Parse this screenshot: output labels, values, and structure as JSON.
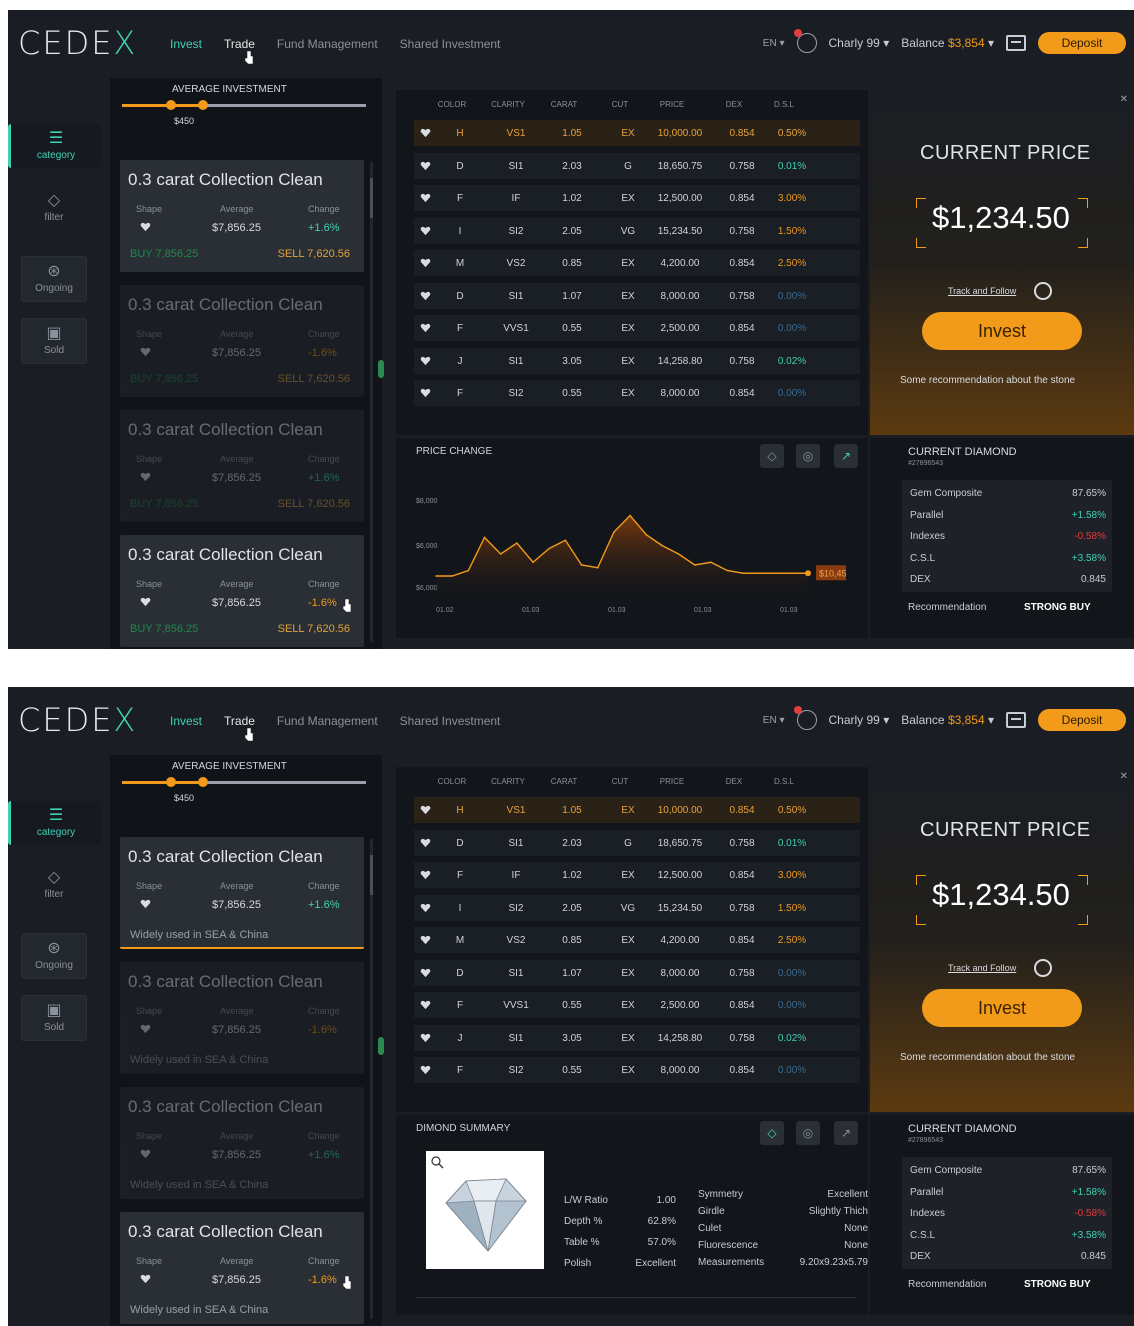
{
  "app": {
    "logo": "CEDEX",
    "nav": [
      "Invest",
      "Trade",
      "Fund Management",
      "Shared Investment"
    ],
    "lang": "EN",
    "user": "Charly 99",
    "balance_label": "Balance",
    "balance_value": "$3,854",
    "deposit": "Deposit"
  },
  "rail": {
    "items": [
      {
        "label": "category",
        "icon": "list-icon"
      },
      {
        "label": "filter",
        "icon": "diamond-icon"
      },
      {
        "label": "Ongoing",
        "icon": "ongoing-icon"
      },
      {
        "label": "Sold",
        "icon": "sold-icon"
      }
    ]
  },
  "average": {
    "title": "AVERAGE INVESTMENT",
    "value": "$450"
  },
  "card_labels": {
    "shape": "Shape",
    "average": "Average",
    "change": "Change"
  },
  "cards": [
    {
      "title": "0.3 carat Collection Clean",
      "average": "$7,856.25",
      "change": "+1.6%",
      "buy": "BUY 7,856.25",
      "sell": "SELL 7,620.56",
      "note": "Widely used in SEA & China"
    },
    {
      "title": "0.3 carat Collection Clean",
      "average": "$7,856.25",
      "change": "-1.6%",
      "buy": "BUY 7,856.25",
      "sell": "SELL 7,620.56",
      "note": "Widely used in SEA & China"
    },
    {
      "title": "0.3 carat Collection Clean",
      "average": "$7,856.25",
      "change": "+1.6%",
      "buy": "BUY 7,856.25",
      "sell": "SELL 7,620.56",
      "note": "Widely used in SEA & China"
    },
    {
      "title": "0.3 carat Collection Clean",
      "average": "$7,856.25",
      "change": "-1.6%",
      "buy": "BUY 7,856.25",
      "sell": "SELL 7,620.56",
      "note": "Widely used in SEA & China"
    }
  ],
  "table": {
    "headers": [
      "COLOR",
      "CLARITY",
      "CARAT",
      "CUT",
      "PRICE",
      "DEX",
      "D.S.L"
    ],
    "rows": [
      [
        "H",
        "VS1",
        "1.05",
        "EX",
        "10,000.00",
        "0.854",
        "0.50%"
      ],
      [
        "D",
        "SI1",
        "2.03",
        "G",
        "18,650.75",
        "0.758",
        "0.01%"
      ],
      [
        "F",
        "IF",
        "1.02",
        "EX",
        "12,500.00",
        "0.854",
        "3.00%"
      ],
      [
        "I",
        "SI2",
        "2.05",
        "VG",
        "15,234.50",
        "0.758",
        "1.50%"
      ],
      [
        "M",
        "VS2",
        "0.85",
        "EX",
        "4,200.00",
        "0.854",
        "2.50%"
      ],
      [
        "D",
        "SI1",
        "1.07",
        "EX",
        "8,000.00",
        "0.758",
        "0.00%"
      ],
      [
        "F",
        "VVS1",
        "0.55",
        "EX",
        "2,500.00",
        "0.854",
        "0.00%"
      ],
      [
        "J",
        "SI1",
        "3.05",
        "EX",
        "14,258.80",
        "0.758",
        "0.02%"
      ],
      [
        "F",
        "SI2",
        "0.55",
        "EX",
        "8,000.00",
        "0.854",
        "0.00%"
      ]
    ]
  },
  "price_panel": {
    "title": "CURRENT PRICE",
    "price": "$1,234.50",
    "track": "Track and Follow",
    "invest": "Invest",
    "recommendation": "Some recommendation about the stone"
  },
  "price_change": {
    "title": "PRICE CHANGE",
    "last_label": "$10,457"
  },
  "chart_data": {
    "type": "area",
    "title": "PRICE CHANGE",
    "ytick_labels": [
      "$8,000",
      "$6,000",
      "$6,000"
    ],
    "xtick_labels": [
      "01.02",
      "01.03",
      "01.03",
      "01.03",
      "01.03"
    ],
    "values": [
      5.8,
      5.8,
      6.0,
      7.2,
      6.6,
      7.0,
      6.3,
      6.8,
      7.1,
      6.2,
      6.1,
      7.4,
      8.0,
      7.3,
      6.9,
      6.6,
      6.2,
      6.3,
      6.0,
      5.9,
      5.9,
      5.9,
      5.9,
      5.9
    ],
    "series": [
      {
        "values": [
          5.8,
          5.8,
          6.0,
          7.2,
          6.6,
          7.0,
          6.3,
          6.8,
          7.1,
          6.2,
          6.1,
          7.4,
          8.0,
          7.3,
          6.9,
          6.6,
          6.2,
          6.3,
          6.0,
          5.9,
          5.9,
          5.9,
          5.9,
          5.9
        ]
      }
    ],
    "ylim": [
      5,
      9
    ],
    "annotation": "$10,457",
    "colors": {
      "line": "#f29a19",
      "fill_top": "#7a3a0c"
    }
  },
  "current_diamond": {
    "title": "CURRENT DIAMOND",
    "id": "#27896543",
    "rows": [
      {
        "label": "Gem Composite",
        "value": "87.65%"
      },
      {
        "label": "Parallel",
        "value": "+1.58%"
      },
      {
        "label": "Indexes",
        "value": "-0.58%"
      },
      {
        "label": "C.S.L",
        "value": "+3.58%"
      },
      {
        "label": "DEX",
        "value": "0.845"
      }
    ],
    "rec_label": "Recommendation",
    "rec_value": "STRONG BUY"
  },
  "summary": {
    "title": "DIMOND SUMMARY",
    "left": [
      {
        "label": "L/W Ratio",
        "value": "1.00"
      },
      {
        "label": "Depth %",
        "value": "62.8%"
      },
      {
        "label": "Table %",
        "value": "57.0%"
      },
      {
        "label": "Polish",
        "value": "Excellent"
      }
    ],
    "right": [
      {
        "label": "Symmetry",
        "value": "Excellent"
      },
      {
        "label": "Girdle",
        "value": "Slightly Thich"
      },
      {
        "label": "Culet",
        "value": "None"
      },
      {
        "label": "Fluorescence",
        "value": "None"
      },
      {
        "label": "Measurements",
        "value": "9.20x9.23x5.79"
      }
    ]
  },
  "colors": {
    "accent": "#3fd1b4",
    "orange": "#f29a19",
    "bg": "#1a1d23"
  }
}
